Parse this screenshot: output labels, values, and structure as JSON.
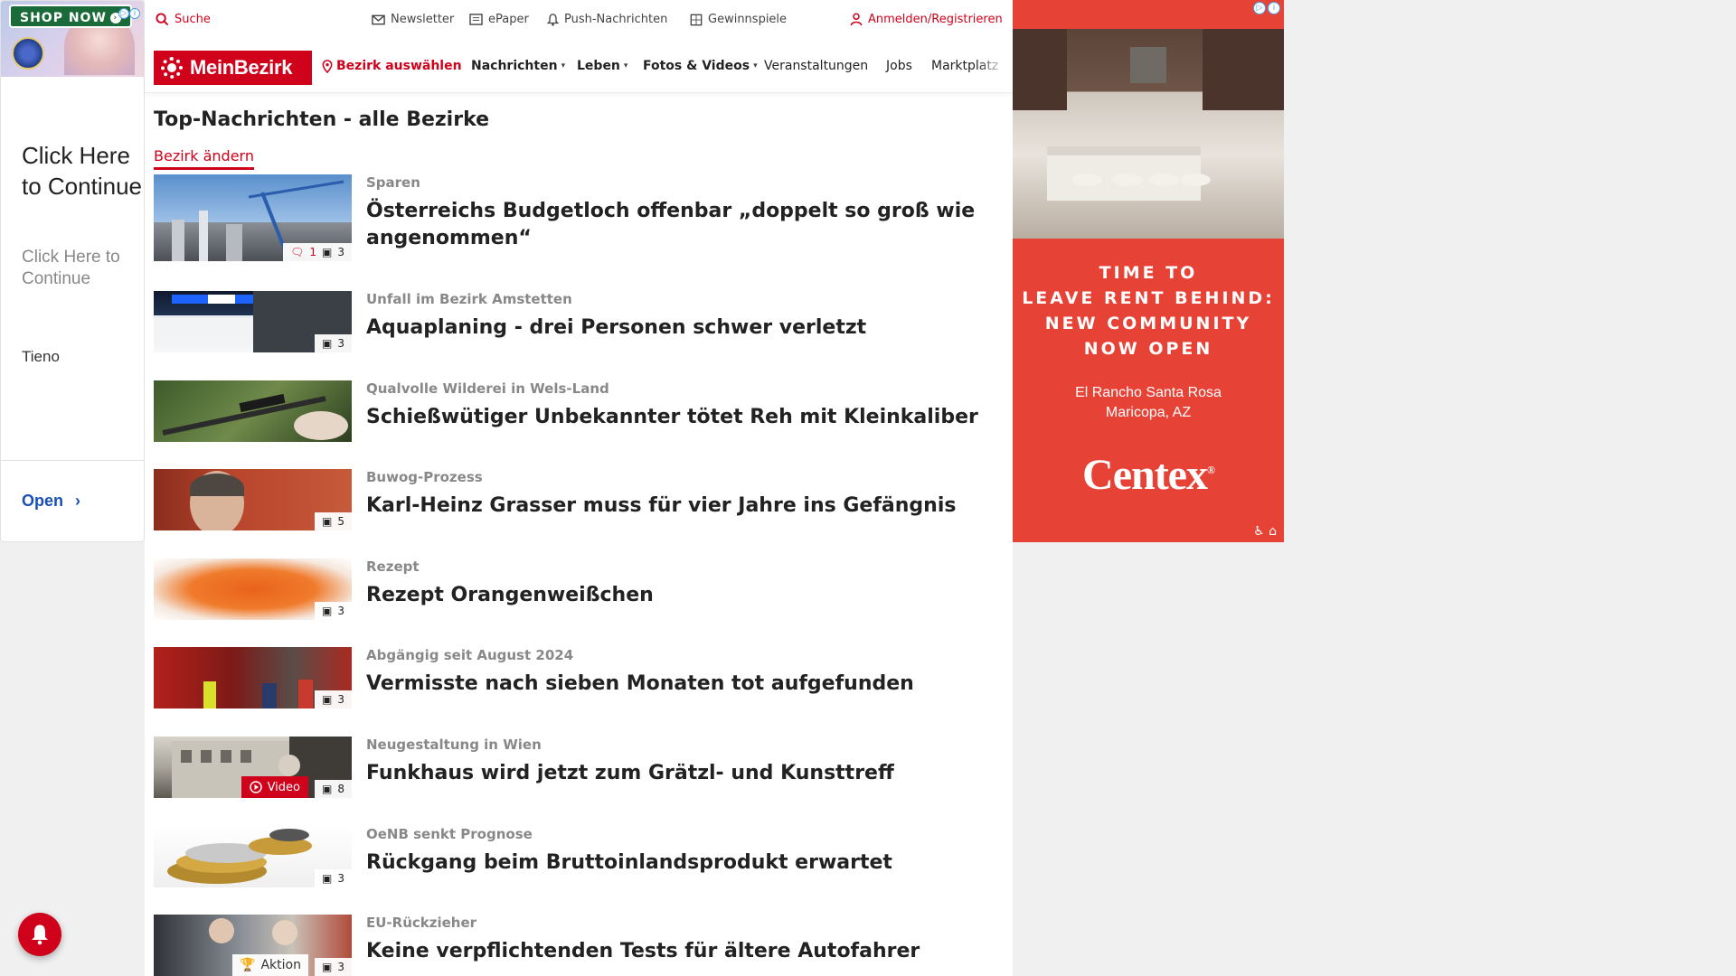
{
  "left_ad": {
    "shop_now": "SHOP NOW",
    "click_big": "Click Here to Continue",
    "click_small": "Click Here to Continue",
    "brand": "Tieno",
    "open": "Open"
  },
  "utility": {
    "search": "Suche",
    "newsletter": "Newsletter",
    "epaper": "ePaper",
    "push": "Push-Nachrichten",
    "games": "Gewinnspiele",
    "login": "Anmelden/Registrieren"
  },
  "nav": {
    "logo": "MeinBezirk",
    "district": "Bezirk auswählen",
    "items": [
      "Nachrichten",
      "Leben",
      "Fotos & Videos",
      "Veranstaltungen",
      "Jobs",
      "Marktplatz"
    ]
  },
  "section": {
    "title": "Top-Nachrichten - alle Bezirke",
    "change": "Bezirk ändern"
  },
  "articles": [
    {
      "kicker": "Sparen",
      "headline": "Österreichs Budgetloch offenbar „doppelt so groß wie angenommen“",
      "comments": "1",
      "photos": "3"
    },
    {
      "kicker": "Unfall im Bezirk Amstetten",
      "headline": "Aquaplaning - drei Personen schwer verletzt",
      "photos": "3"
    },
    {
      "kicker": "Qualvolle Wilderei in Wels-Land",
      "headline": "Schießwütiger Unbekannter tötet Reh mit Kleinkaliber"
    },
    {
      "kicker": "Buwog-Prozess",
      "headline": "Karl-Heinz Grasser muss für vier Jahre ins Gefängnis",
      "photos": "5"
    },
    {
      "kicker": "Rezept",
      "headline": "Rezept Orangenweißchen",
      "photos": "3"
    },
    {
      "kicker": "Abgängig seit August 2024",
      "headline": "Vermisste nach sieben Monaten tot aufgefunden",
      "photos": "3"
    },
    {
      "kicker": "Neugestaltung in Wien",
      "headline": "Funkhaus wird jetzt zum Grätzl- und Kunsttreff",
      "video": "Video",
      "photos": "8"
    },
    {
      "kicker": "OeNB senkt Prognose",
      "headline": "Rückgang beim Bruttoinlandsprodukt erwartet",
      "photos": "3"
    },
    {
      "kicker": "EU-Rückzieher",
      "headline": "Keine verpflichtenden Tests für ältere Autofahrer",
      "aktion": "Aktion",
      "photos": "3"
    }
  ],
  "right_ad": {
    "headline": [
      "TIME TO",
      "LEAVE RENT BEHIND:",
      "NEW COMMUNITY",
      "NOW OPEN"
    ],
    "location": [
      "El Rancho Santa Rosa",
      "Maricopa, AZ"
    ],
    "brand": "Centex",
    "brand_mark": "®"
  },
  "colors": {
    "brand_red": "#d0021b",
    "ad_red": "#e74236",
    "ad_green": "#1b6b3a"
  }
}
